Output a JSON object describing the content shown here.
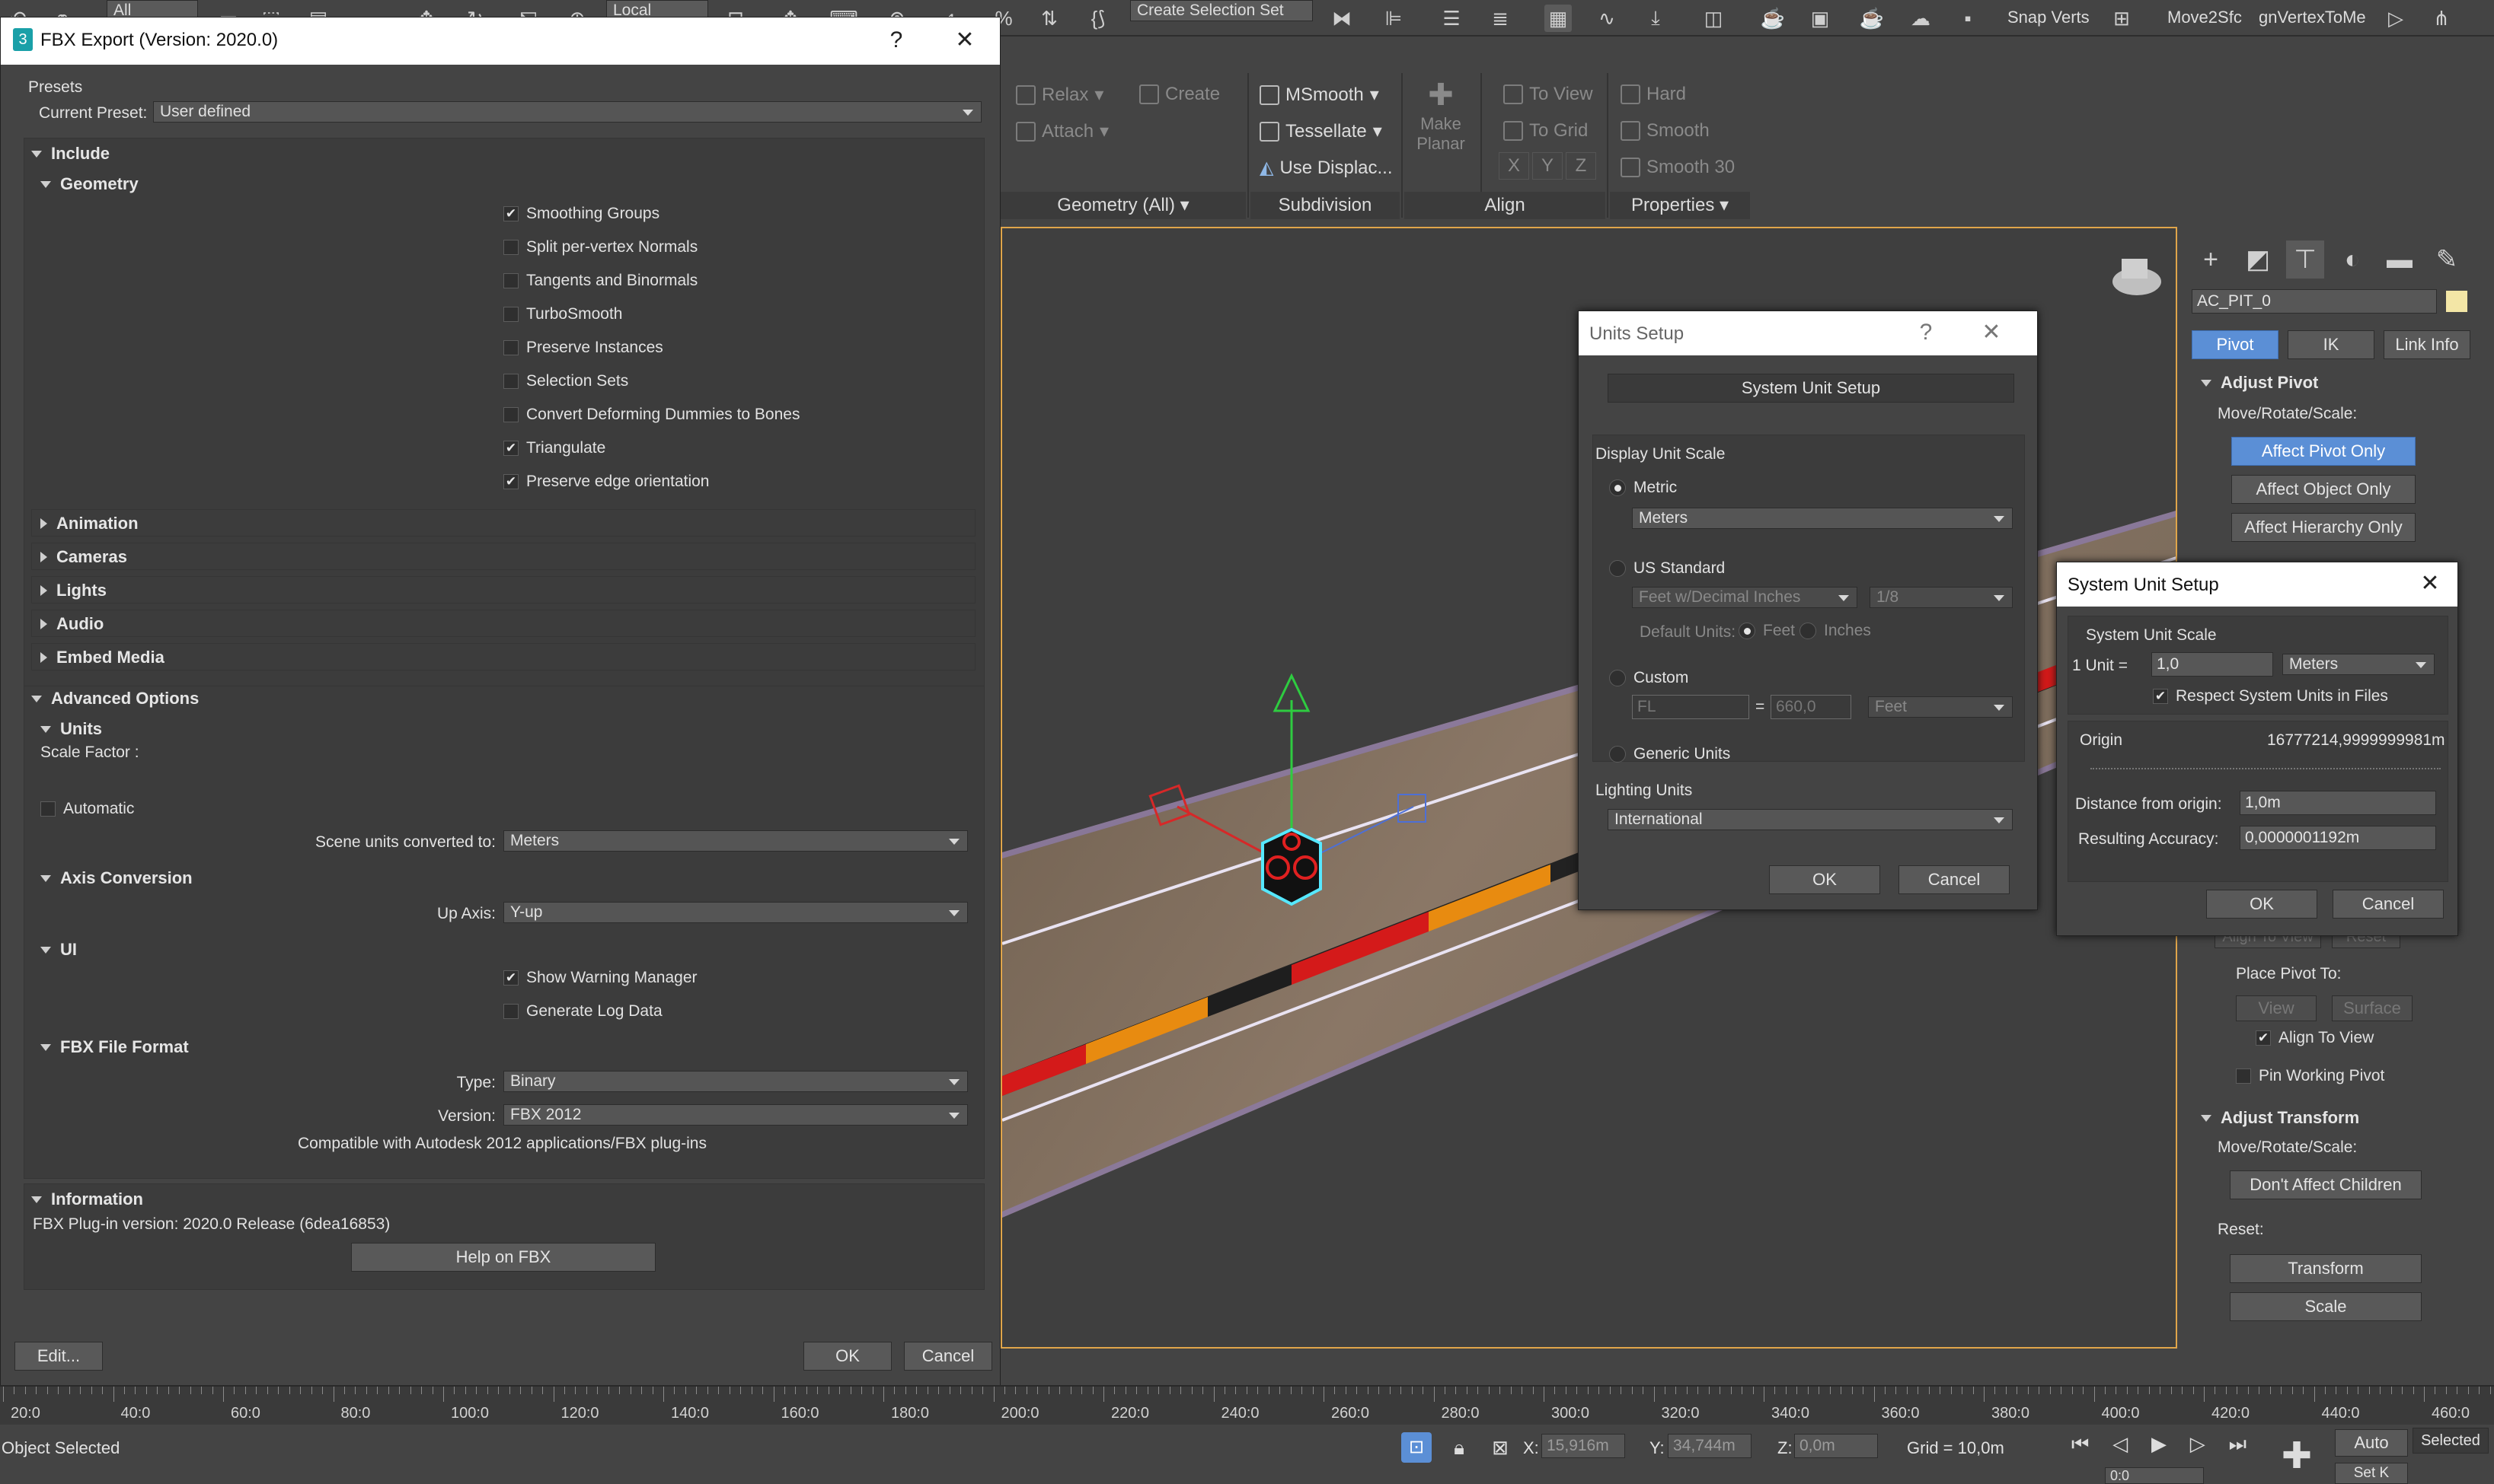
{
  "toolbar": {
    "filter_dropdown": "All",
    "coord_dropdown": "Local",
    "selection_set_dropdown": "Create Selection Set",
    "snap_verts": "Snap Verts",
    "move2sfc": "Move2Sfc",
    "gnvertex": "gnVertexToMe"
  },
  "ribbon": {
    "relax": "Relax",
    "attach": "Attach",
    "create": "Create",
    "msmooth": "MSmooth",
    "tessellate": "Tessellate",
    "use_displace": "Use Displac...",
    "make_planar": "Make Planar",
    "to_view": "To View",
    "to_grid": "To Grid",
    "x": "X",
    "y": "Y",
    "z": "Z",
    "hard": "Hard",
    "smooth": "Smooth",
    "smooth30": "Smooth 30",
    "groups": [
      "Geometry (All)",
      "Subdivision",
      "Align",
      "Properties"
    ]
  },
  "fbx": {
    "title": "FBX Export (Version: 2020.0)",
    "help_glyph": "?",
    "close_glyph": "✕",
    "presets_label": "Presets",
    "current_preset_label": "Current Preset:",
    "current_preset_value": "User defined",
    "include": "Include",
    "geometry": "Geometry",
    "geometry_options": [
      {
        "label": "Smoothing Groups",
        "checked": true
      },
      {
        "label": "Split per-vertex Normals",
        "checked": false
      },
      {
        "label": "Tangents and Binormals",
        "checked": false
      },
      {
        "label": "TurboSmooth",
        "checked": false
      },
      {
        "label": "Preserve Instances",
        "checked": false
      },
      {
        "label": "Selection Sets",
        "checked": false
      },
      {
        "label": "Convert Deforming Dummies to Bones",
        "checked": false
      },
      {
        "label": "Triangulate",
        "checked": true
      },
      {
        "label": "Preserve edge orientation",
        "checked": true
      }
    ],
    "collapsed_sections": [
      "Animation",
      "Cameras",
      "Lights",
      "Audio",
      "Embed Media"
    ],
    "advanced_options": "Advanced Options",
    "units": "Units",
    "scale_factor": "Scale Factor :",
    "automatic": "Automatic",
    "scene_units_label": "Scene units converted to:",
    "scene_units_value": "Meters",
    "axis_conversion": "Axis Conversion",
    "up_axis_label": "Up Axis:",
    "up_axis_value": "Y-up",
    "ui": "UI",
    "show_warning_manager": "Show Warning Manager",
    "generate_log_data": "Generate Log Data",
    "fbx_file_format": "FBX File Format",
    "type_label": "Type:",
    "type_value": "Binary",
    "version_label": "Version:",
    "version_value": "FBX 2012",
    "compat_note": "Compatible with Autodesk 2012 applications/FBX plug-ins",
    "information": "Information",
    "plugin_version": "FBX Plug-in version: 2020.0 Release (6dea16853)",
    "help_button": "Help on FBX",
    "edit_button": "Edit...",
    "ok_button": "OK",
    "cancel_button": "Cancel"
  },
  "units_dialog": {
    "title": "Units Setup",
    "help_glyph": "?",
    "close_glyph": "✕",
    "system_unit_setup_button": "System Unit Setup",
    "display_unit_scale": "Display Unit Scale",
    "metric": "Metric",
    "metric_value": "Meters",
    "us_standard": "US Standard",
    "us_value": "Feet w/Decimal Inches",
    "fraction_value": "1/8",
    "default_units": "Default Units:",
    "feet": "Feet",
    "inches": "Inches",
    "custom": "Custom",
    "custom_name": "FL",
    "equals": "=",
    "custom_value": "660,0",
    "custom_unit": "Feet",
    "generic_units": "Generic Units",
    "lighting_units": "Lighting Units",
    "lighting_value": "International",
    "ok": "OK",
    "cancel": "Cancel"
  },
  "sys_dialog": {
    "title": "System Unit Setup",
    "close_glyph": "✕",
    "system_unit_scale": "System Unit Scale",
    "one_unit": "1 Unit =",
    "unit_value": "1,0",
    "unit_type": "Meters",
    "respect": "Respect System Units in Files",
    "origin": "Origin",
    "origin_value": "16777214,9999999981m",
    "distance_label": "Distance from origin:",
    "distance_value": "1,0m",
    "accuracy_label": "Resulting Accuracy:",
    "accuracy_value": "0,0000001192m",
    "ok": "OK",
    "cancel": "Cancel"
  },
  "command_panel": {
    "object_name": "AC_PIT_0",
    "tabs": [
      "Pivot",
      "IK",
      "Link Info"
    ],
    "adjust_pivot": "Adjust Pivot",
    "move_rotate_scale": "Move/Rotate/Scale:",
    "affect_pivot_only": "Affect Pivot Only",
    "affect_object_only": "Affect Object Only",
    "affect_hierarchy_only": "Affect Hierarchy Only",
    "align_to_view": "Align To View",
    "reset": "Reset",
    "place_pivot_to": "Place Pivot To:",
    "view": "View",
    "surface": "Surface",
    "align_to_view_chk": "Align To View",
    "pin_working_pivot": "Pin Working Pivot",
    "adjust_transform": "Adjust Transform",
    "move_rotate_scale2": "Move/Rotate/Scale:",
    "dont_affect_children": "Don't Affect Children",
    "reset_label": "Reset:",
    "transform": "Transform",
    "scale": "Scale"
  },
  "timeline": {
    "ticks": [
      "20:0",
      "40:0",
      "60:0",
      "80:0",
      "100:0",
      "120:0",
      "140:0",
      "160:0",
      "180:0",
      "200:0",
      "220:0",
      "240:0",
      "260:0",
      "280:0",
      "300:0",
      "320:0",
      "340:0",
      "360:0",
      "380:0",
      "400:0",
      "420:0",
      "440:0",
      "460:0"
    ]
  },
  "status": {
    "object_selected": "Object Selected",
    "x_label": "X:",
    "x_value": "15,916m",
    "y_label": "Y:",
    "y_value": "34,744m",
    "z_label": "Z:",
    "z_value": "0,0m",
    "grid": "Grid = 10,0m",
    "auto": "Auto",
    "selected": "Selected",
    "frame_value": "0:0",
    "set_k": "Set K"
  },
  "colors": {
    "accent_blue": "#5b8fd6",
    "viewport_border": "#e0a54a",
    "dialog_bg": "#444444"
  }
}
